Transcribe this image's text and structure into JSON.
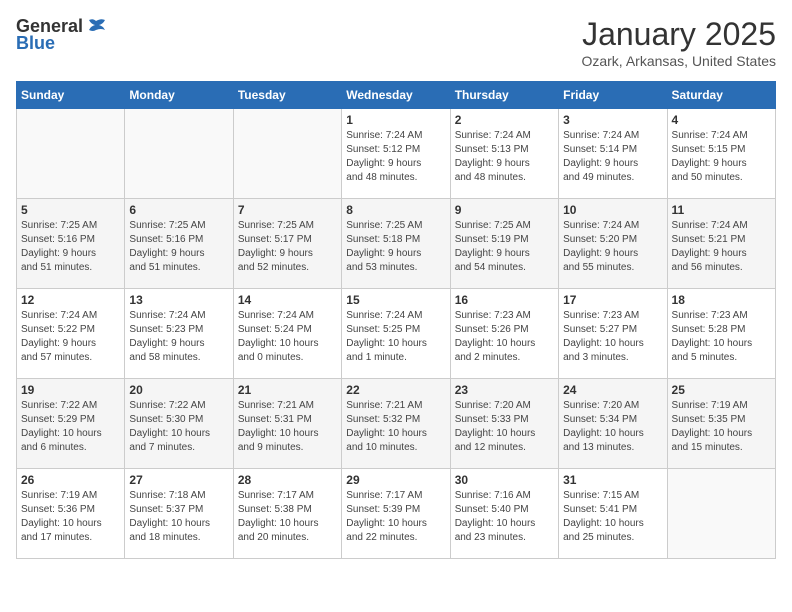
{
  "logo": {
    "general": "General",
    "blue": "Blue"
  },
  "title": "January 2025",
  "subtitle": "Ozark, Arkansas, United States",
  "days_of_week": [
    "Sunday",
    "Monday",
    "Tuesday",
    "Wednesday",
    "Thursday",
    "Friday",
    "Saturday"
  ],
  "weeks": [
    [
      {
        "day": "",
        "content": ""
      },
      {
        "day": "",
        "content": ""
      },
      {
        "day": "",
        "content": ""
      },
      {
        "day": "1",
        "content": "Sunrise: 7:24 AM\nSunset: 5:12 PM\nDaylight: 9 hours\nand 48 minutes."
      },
      {
        "day": "2",
        "content": "Sunrise: 7:24 AM\nSunset: 5:13 PM\nDaylight: 9 hours\nand 48 minutes."
      },
      {
        "day": "3",
        "content": "Sunrise: 7:24 AM\nSunset: 5:14 PM\nDaylight: 9 hours\nand 49 minutes."
      },
      {
        "day": "4",
        "content": "Sunrise: 7:24 AM\nSunset: 5:15 PM\nDaylight: 9 hours\nand 50 minutes."
      }
    ],
    [
      {
        "day": "5",
        "content": "Sunrise: 7:25 AM\nSunset: 5:16 PM\nDaylight: 9 hours\nand 51 minutes."
      },
      {
        "day": "6",
        "content": "Sunrise: 7:25 AM\nSunset: 5:16 PM\nDaylight: 9 hours\nand 51 minutes."
      },
      {
        "day": "7",
        "content": "Sunrise: 7:25 AM\nSunset: 5:17 PM\nDaylight: 9 hours\nand 52 minutes."
      },
      {
        "day": "8",
        "content": "Sunrise: 7:25 AM\nSunset: 5:18 PM\nDaylight: 9 hours\nand 53 minutes."
      },
      {
        "day": "9",
        "content": "Sunrise: 7:25 AM\nSunset: 5:19 PM\nDaylight: 9 hours\nand 54 minutes."
      },
      {
        "day": "10",
        "content": "Sunrise: 7:24 AM\nSunset: 5:20 PM\nDaylight: 9 hours\nand 55 minutes."
      },
      {
        "day": "11",
        "content": "Sunrise: 7:24 AM\nSunset: 5:21 PM\nDaylight: 9 hours\nand 56 minutes."
      }
    ],
    [
      {
        "day": "12",
        "content": "Sunrise: 7:24 AM\nSunset: 5:22 PM\nDaylight: 9 hours\nand 57 minutes."
      },
      {
        "day": "13",
        "content": "Sunrise: 7:24 AM\nSunset: 5:23 PM\nDaylight: 9 hours\nand 58 minutes."
      },
      {
        "day": "14",
        "content": "Sunrise: 7:24 AM\nSunset: 5:24 PM\nDaylight: 10 hours\nand 0 minutes."
      },
      {
        "day": "15",
        "content": "Sunrise: 7:24 AM\nSunset: 5:25 PM\nDaylight: 10 hours\nand 1 minute."
      },
      {
        "day": "16",
        "content": "Sunrise: 7:23 AM\nSunset: 5:26 PM\nDaylight: 10 hours\nand 2 minutes."
      },
      {
        "day": "17",
        "content": "Sunrise: 7:23 AM\nSunset: 5:27 PM\nDaylight: 10 hours\nand 3 minutes."
      },
      {
        "day": "18",
        "content": "Sunrise: 7:23 AM\nSunset: 5:28 PM\nDaylight: 10 hours\nand 5 minutes."
      }
    ],
    [
      {
        "day": "19",
        "content": "Sunrise: 7:22 AM\nSunset: 5:29 PM\nDaylight: 10 hours\nand 6 minutes."
      },
      {
        "day": "20",
        "content": "Sunrise: 7:22 AM\nSunset: 5:30 PM\nDaylight: 10 hours\nand 7 minutes."
      },
      {
        "day": "21",
        "content": "Sunrise: 7:21 AM\nSunset: 5:31 PM\nDaylight: 10 hours\nand 9 minutes."
      },
      {
        "day": "22",
        "content": "Sunrise: 7:21 AM\nSunset: 5:32 PM\nDaylight: 10 hours\nand 10 minutes."
      },
      {
        "day": "23",
        "content": "Sunrise: 7:20 AM\nSunset: 5:33 PM\nDaylight: 10 hours\nand 12 minutes."
      },
      {
        "day": "24",
        "content": "Sunrise: 7:20 AM\nSunset: 5:34 PM\nDaylight: 10 hours\nand 13 minutes."
      },
      {
        "day": "25",
        "content": "Sunrise: 7:19 AM\nSunset: 5:35 PM\nDaylight: 10 hours\nand 15 minutes."
      }
    ],
    [
      {
        "day": "26",
        "content": "Sunrise: 7:19 AM\nSunset: 5:36 PM\nDaylight: 10 hours\nand 17 minutes."
      },
      {
        "day": "27",
        "content": "Sunrise: 7:18 AM\nSunset: 5:37 PM\nDaylight: 10 hours\nand 18 minutes."
      },
      {
        "day": "28",
        "content": "Sunrise: 7:17 AM\nSunset: 5:38 PM\nDaylight: 10 hours\nand 20 minutes."
      },
      {
        "day": "29",
        "content": "Sunrise: 7:17 AM\nSunset: 5:39 PM\nDaylight: 10 hours\nand 22 minutes."
      },
      {
        "day": "30",
        "content": "Sunrise: 7:16 AM\nSunset: 5:40 PM\nDaylight: 10 hours\nand 23 minutes."
      },
      {
        "day": "31",
        "content": "Sunrise: 7:15 AM\nSunset: 5:41 PM\nDaylight: 10 hours\nand 25 minutes."
      },
      {
        "day": "",
        "content": ""
      }
    ]
  ]
}
